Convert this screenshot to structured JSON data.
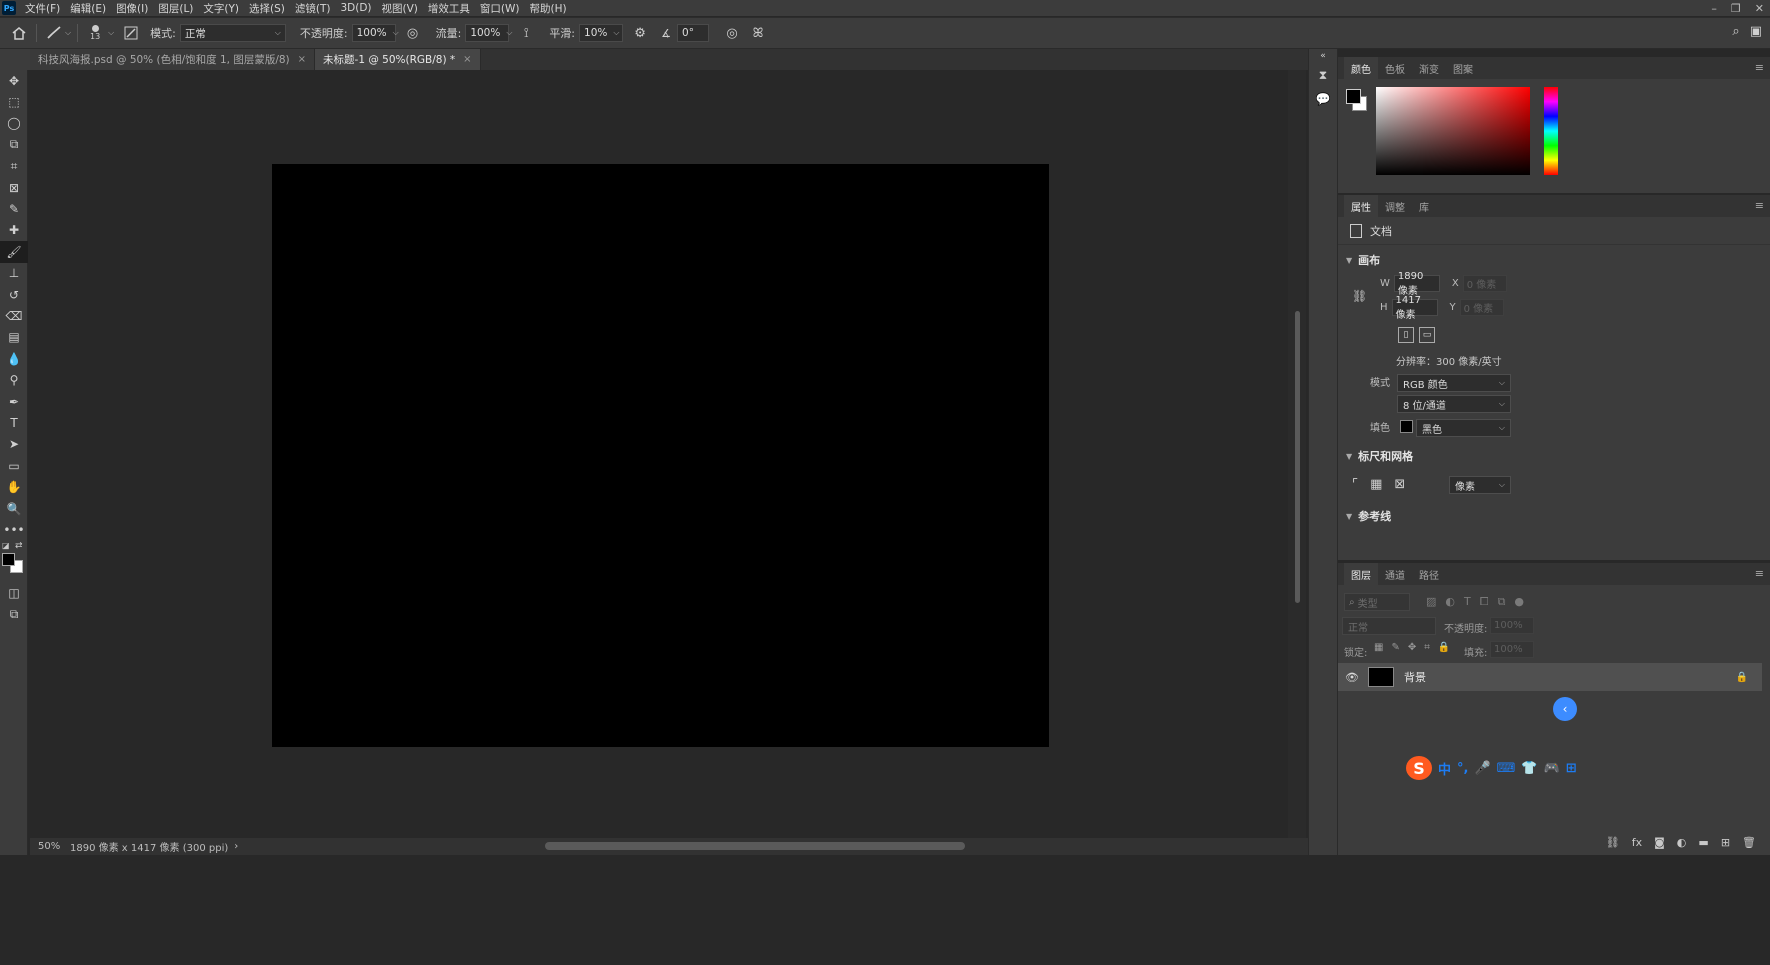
{
  "app": {
    "logo": "Ps"
  },
  "menu": [
    "文件(F)",
    "编辑(E)",
    "图像(I)",
    "图层(L)",
    "文字(Y)",
    "选择(S)",
    "滤镜(T)",
    "3D(D)",
    "视图(V)",
    "增效工具",
    "窗口(W)",
    "帮助(H)"
  ],
  "window_controls": {
    "minimize": "–",
    "restore": "❐",
    "close": "✕"
  },
  "options": {
    "brush_size": "13",
    "mode_label": "模式:",
    "mode_value": "正常",
    "opacity_label": "不透明度:",
    "opacity_value": "100%",
    "flow_label": "流量:",
    "flow_value": "100%",
    "smooth_label": "平滑:",
    "smooth_value": "10%",
    "angle_value": "0°"
  },
  "tabs": [
    {
      "label": "科技风海报.psd @ 50% (色相/饱和度 1, 图层蒙版/8)",
      "close": "×"
    },
    {
      "label": "未标题-1 @ 50%(RGB/8) *",
      "close": "×"
    }
  ],
  "status": {
    "zoom": "50%",
    "dimensions": "1890 像素 x 1417 像素 (300 ppi)",
    "arrow": "›"
  },
  "color_panel": {
    "tabs": [
      "颜色",
      "色板",
      "渐变",
      "图案"
    ],
    "active": "颜色"
  },
  "properties_panel": {
    "tabs": [
      "属性",
      "调整",
      "库"
    ],
    "doc_label": "文档",
    "canvas_section": "画布",
    "w_label": "W",
    "w_value": "1890 像素",
    "h_label": "H",
    "h_value": "1417 像素",
    "x_label": "X",
    "x_value": "0 像素",
    "y_label": "Y",
    "y_value": "0 像素",
    "resolution": "分辨率：300 像素/英寸",
    "mode_label": "模式",
    "mode_value": "RGB 颜色",
    "depth_value": "8 位/通道",
    "fill_label": "填色",
    "fill_value": "黑色",
    "rulers_section": "标尺和网格",
    "units_value": "像素",
    "guides_section": "参考线"
  },
  "layers_panel": {
    "tabs": [
      "图层",
      "通道",
      "路径"
    ],
    "search_placeholder": "类型",
    "blend_mode": "正常",
    "opacity_label": "不透明度:",
    "opacity_value": "100%",
    "lock_label": "锁定:",
    "fill_label": "填充:",
    "fill_value": "100%",
    "layer_name": "背景"
  },
  "ime": {
    "items": [
      "中",
      "°,",
      "🎤",
      "⌨",
      "👕",
      "🎮",
      "⊞"
    ]
  },
  "colors": {
    "foreground": "#000000",
    "background": "#ffffff",
    "canvas": "#000000",
    "panel_bg": "#3c3c3c",
    "workspace": "#282828"
  }
}
